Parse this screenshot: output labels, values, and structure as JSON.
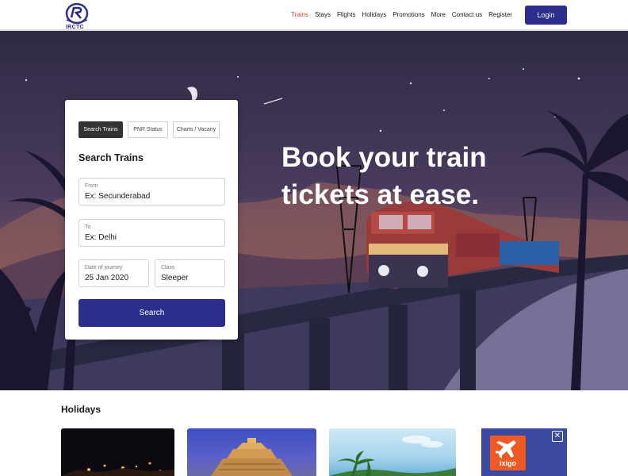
{
  "header": {
    "logo_text": "IRCTC",
    "nav": [
      {
        "label": "Trains",
        "active": true
      },
      {
        "label": "Stays",
        "active": false
      },
      {
        "label": "Flights",
        "active": false
      },
      {
        "label": "Holidays",
        "active": false
      },
      {
        "label": "Promotions",
        "active": false
      },
      {
        "label": "More",
        "active": false
      },
      {
        "label": "Contact us",
        "active": false
      },
      {
        "label": "Register",
        "active": false
      }
    ],
    "login_label": "Login"
  },
  "hero": {
    "title_line1": "Book your train",
    "title_line2": "tickets at ease."
  },
  "search_card": {
    "tabs": [
      "Search Trains",
      "PNR Status",
      "Charts / Vacany"
    ],
    "active_tab": "Search Trains",
    "title": "Search Trains",
    "from": {
      "label": "From",
      "value": "Ex: Secunderabad"
    },
    "to": {
      "label": "To",
      "value": "Ex: Delhi"
    },
    "date": {
      "label": "Date of journey",
      "value": "25 Jan 2020"
    },
    "class": {
      "label": "Class",
      "value": "Sleeper"
    },
    "search_label": "Search"
  },
  "holidays": {
    "title": "Holidays"
  },
  "ad": {
    "brand": "ixigo",
    "close_symbol": "✕"
  },
  "colors": {
    "brand_blue": "#2b2e8c",
    "active_nav": "#e4462c",
    "ixigo_orange": "#ef5a24"
  },
  "icons": {
    "logo": "irctc-logo-icon",
    "plane": "plane-icon",
    "close": "close-icon"
  }
}
